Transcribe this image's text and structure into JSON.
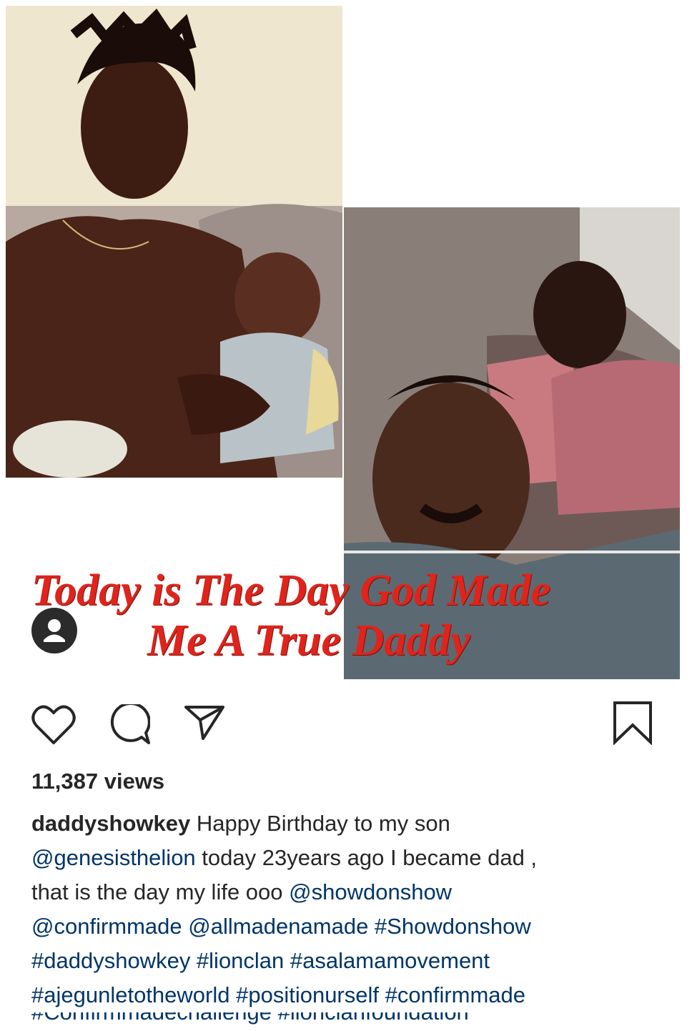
{
  "post": {
    "overlay_line1": "Today is The Day God Made",
    "overlay_line2": "Me A True Daddy",
    "views": "11,387 views",
    "username": "daddyshowkey",
    "caption_text": " Happy Birthday to my son",
    "caption_line2_mention": "@genesisthelion",
    "caption_line2_text": " today 23years ago I became dad ,",
    "caption_line3_text": "that is the day my life ooo ",
    "caption_line3_mention": "@showdonshow",
    "caption_line4": "@confirmmade @allmadenamade #Showdonshow",
    "caption_line5": "#daddyshowkey #lionclan #asalamamovement",
    "caption_line6": "#ajegunletotheworld #positionurself #confirmmade",
    "caption_line7_cut": "#Confirmmadechallenge #lionclanfoundation"
  },
  "icons": {
    "like": "heart-icon",
    "comment": "comment-icon",
    "share": "send-icon",
    "save": "bookmark-icon",
    "avatar": "user-avatar-icon"
  },
  "colors": {
    "overlay_text": "#e0241b",
    "mention": "#003569",
    "text": "#262626"
  }
}
